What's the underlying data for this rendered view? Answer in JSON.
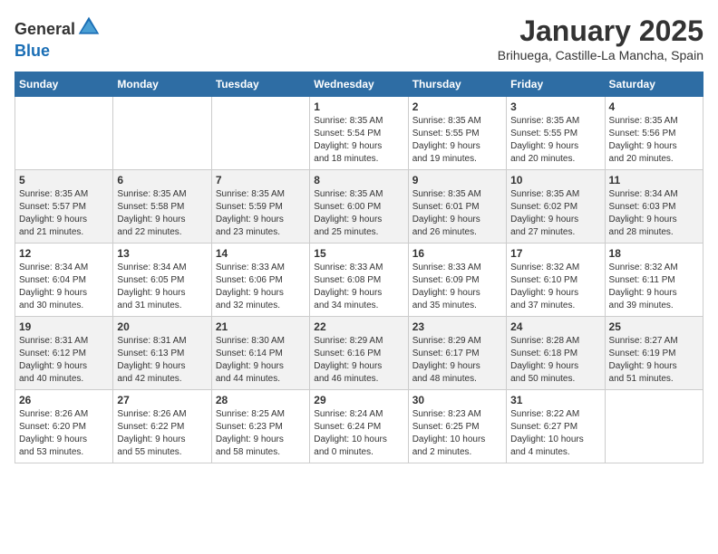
{
  "header": {
    "logo_general": "General",
    "logo_blue": "Blue",
    "month_title": "January 2025",
    "location": "Brihuega, Castille-La Mancha, Spain"
  },
  "days_of_week": [
    "Sunday",
    "Monday",
    "Tuesday",
    "Wednesday",
    "Thursday",
    "Friday",
    "Saturday"
  ],
  "weeks": [
    [
      {
        "date": "",
        "info": ""
      },
      {
        "date": "",
        "info": ""
      },
      {
        "date": "",
        "info": ""
      },
      {
        "date": "1",
        "info": "Sunrise: 8:35 AM\nSunset: 5:54 PM\nDaylight: 9 hours\nand 18 minutes."
      },
      {
        "date": "2",
        "info": "Sunrise: 8:35 AM\nSunset: 5:55 PM\nDaylight: 9 hours\nand 19 minutes."
      },
      {
        "date": "3",
        "info": "Sunrise: 8:35 AM\nSunset: 5:55 PM\nDaylight: 9 hours\nand 20 minutes."
      },
      {
        "date": "4",
        "info": "Sunrise: 8:35 AM\nSunset: 5:56 PM\nDaylight: 9 hours\nand 20 minutes."
      }
    ],
    [
      {
        "date": "5",
        "info": "Sunrise: 8:35 AM\nSunset: 5:57 PM\nDaylight: 9 hours\nand 21 minutes."
      },
      {
        "date": "6",
        "info": "Sunrise: 8:35 AM\nSunset: 5:58 PM\nDaylight: 9 hours\nand 22 minutes."
      },
      {
        "date": "7",
        "info": "Sunrise: 8:35 AM\nSunset: 5:59 PM\nDaylight: 9 hours\nand 23 minutes."
      },
      {
        "date": "8",
        "info": "Sunrise: 8:35 AM\nSunset: 6:00 PM\nDaylight: 9 hours\nand 25 minutes."
      },
      {
        "date": "9",
        "info": "Sunrise: 8:35 AM\nSunset: 6:01 PM\nDaylight: 9 hours\nand 26 minutes."
      },
      {
        "date": "10",
        "info": "Sunrise: 8:35 AM\nSunset: 6:02 PM\nDaylight: 9 hours\nand 27 minutes."
      },
      {
        "date": "11",
        "info": "Sunrise: 8:34 AM\nSunset: 6:03 PM\nDaylight: 9 hours\nand 28 minutes."
      }
    ],
    [
      {
        "date": "12",
        "info": "Sunrise: 8:34 AM\nSunset: 6:04 PM\nDaylight: 9 hours\nand 30 minutes."
      },
      {
        "date": "13",
        "info": "Sunrise: 8:34 AM\nSunset: 6:05 PM\nDaylight: 9 hours\nand 31 minutes."
      },
      {
        "date": "14",
        "info": "Sunrise: 8:33 AM\nSunset: 6:06 PM\nDaylight: 9 hours\nand 32 minutes."
      },
      {
        "date": "15",
        "info": "Sunrise: 8:33 AM\nSunset: 6:08 PM\nDaylight: 9 hours\nand 34 minutes."
      },
      {
        "date": "16",
        "info": "Sunrise: 8:33 AM\nSunset: 6:09 PM\nDaylight: 9 hours\nand 35 minutes."
      },
      {
        "date": "17",
        "info": "Sunrise: 8:32 AM\nSunset: 6:10 PM\nDaylight: 9 hours\nand 37 minutes."
      },
      {
        "date": "18",
        "info": "Sunrise: 8:32 AM\nSunset: 6:11 PM\nDaylight: 9 hours\nand 39 minutes."
      }
    ],
    [
      {
        "date": "19",
        "info": "Sunrise: 8:31 AM\nSunset: 6:12 PM\nDaylight: 9 hours\nand 40 minutes."
      },
      {
        "date": "20",
        "info": "Sunrise: 8:31 AM\nSunset: 6:13 PM\nDaylight: 9 hours\nand 42 minutes."
      },
      {
        "date": "21",
        "info": "Sunrise: 8:30 AM\nSunset: 6:14 PM\nDaylight: 9 hours\nand 44 minutes."
      },
      {
        "date": "22",
        "info": "Sunrise: 8:29 AM\nSunset: 6:16 PM\nDaylight: 9 hours\nand 46 minutes."
      },
      {
        "date": "23",
        "info": "Sunrise: 8:29 AM\nSunset: 6:17 PM\nDaylight: 9 hours\nand 48 minutes."
      },
      {
        "date": "24",
        "info": "Sunrise: 8:28 AM\nSunset: 6:18 PM\nDaylight: 9 hours\nand 50 minutes."
      },
      {
        "date": "25",
        "info": "Sunrise: 8:27 AM\nSunset: 6:19 PM\nDaylight: 9 hours\nand 51 minutes."
      }
    ],
    [
      {
        "date": "26",
        "info": "Sunrise: 8:26 AM\nSunset: 6:20 PM\nDaylight: 9 hours\nand 53 minutes."
      },
      {
        "date": "27",
        "info": "Sunrise: 8:26 AM\nSunset: 6:22 PM\nDaylight: 9 hours\nand 55 minutes."
      },
      {
        "date": "28",
        "info": "Sunrise: 8:25 AM\nSunset: 6:23 PM\nDaylight: 9 hours\nand 58 minutes."
      },
      {
        "date": "29",
        "info": "Sunrise: 8:24 AM\nSunset: 6:24 PM\nDaylight: 10 hours\nand 0 minutes."
      },
      {
        "date": "30",
        "info": "Sunrise: 8:23 AM\nSunset: 6:25 PM\nDaylight: 10 hours\nand 2 minutes."
      },
      {
        "date": "31",
        "info": "Sunrise: 8:22 AM\nSunset: 6:27 PM\nDaylight: 10 hours\nand 4 minutes."
      },
      {
        "date": "",
        "info": ""
      }
    ]
  ]
}
